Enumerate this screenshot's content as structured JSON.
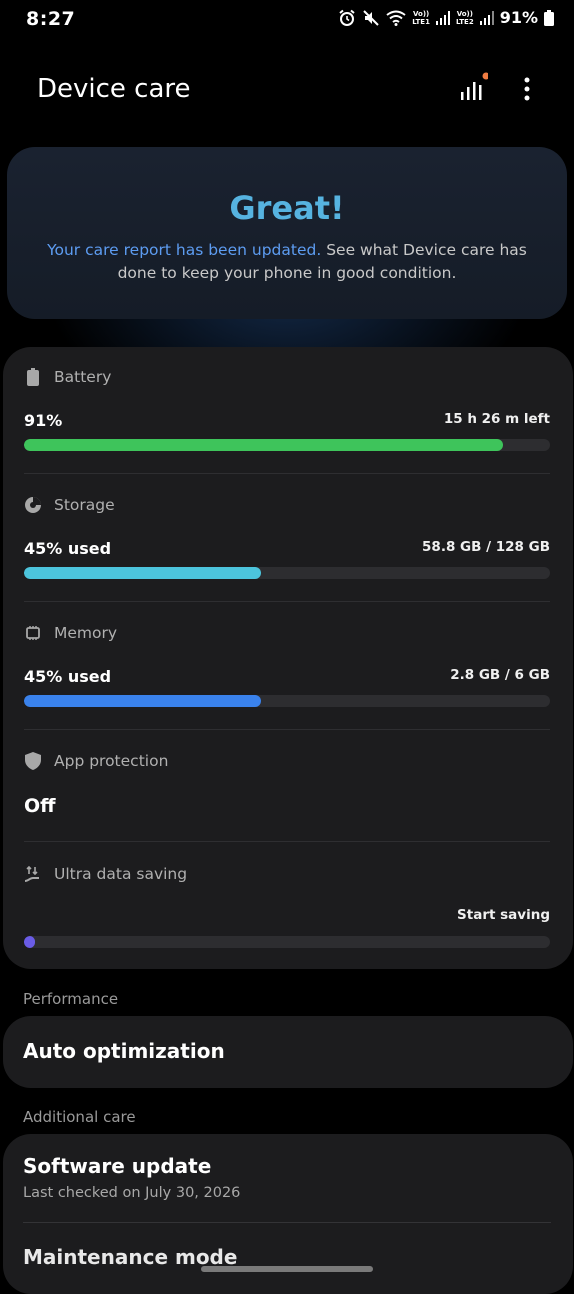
{
  "status_bar": {
    "time": "8:27",
    "sim1": [
      "Vo))",
      "LTE1"
    ],
    "sim2": [
      "Vo))",
      "LTE2"
    ],
    "battery_percent": "91%"
  },
  "header": {
    "title": "Device care"
  },
  "hero": {
    "title": "Great!",
    "link_text": "Your care report has been updated.",
    "body_text": " See what Device care has done to keep your phone in good condition."
  },
  "battery": {
    "label": "Battery",
    "value": "91%",
    "detail": "15 h 26 m left",
    "level": 0.91,
    "color": "#3ec45b"
  },
  "storage": {
    "label": "Storage",
    "value": "45% used",
    "detail": "58.8 GB / 128 GB",
    "level": 0.45,
    "color": "#4cc4dc"
  },
  "memory": {
    "label": "Memory",
    "value": "45% used",
    "detail": "2.8 GB / 6 GB",
    "level": 0.45,
    "color": "#3a82ec"
  },
  "app_protection": {
    "label": "App protection",
    "value": "Off"
  },
  "ultra_data_saving": {
    "label": "Ultra data saving",
    "action": "Start saving",
    "level": 0.02,
    "color": "#6a5ce6"
  },
  "performance": {
    "section_label": "Performance",
    "auto_optimization": "Auto optimization"
  },
  "additional_care": {
    "section_label": "Additional care",
    "software_update": "Software update",
    "software_update_sub": "Last checked on July 30, 2026",
    "maintenance_mode": "Maintenance mode"
  }
}
